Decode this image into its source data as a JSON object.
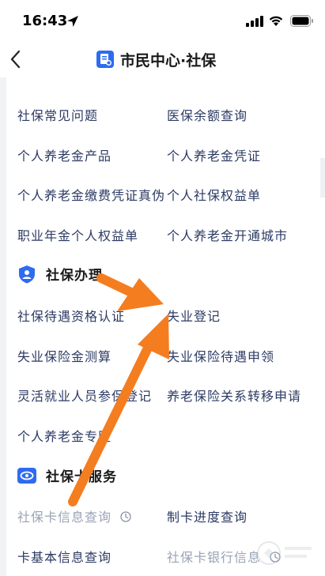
{
  "status_bar": {
    "time": "16:43"
  },
  "nav": {
    "title": "市民中心·社保"
  },
  "faq_items": [
    [
      "社保常见问题",
      "医保余额查询"
    ],
    [
      "个人养老金产品",
      "个人养老金凭证"
    ],
    [
      "个人养老金缴费凭证真伪",
      "个人社保权益单"
    ],
    [
      "职业年金个人权益单",
      "个人养老金开通城市"
    ]
  ],
  "sections": {
    "handling": {
      "title": "社保办理",
      "items": [
        [
          "社保待遇资格认证",
          "失业登记"
        ],
        [
          "失业保险金测算",
          "失业保险待遇申领"
        ],
        [
          "灵活就业人员参保登记",
          "养老保险关系转移申请"
        ],
        [
          "个人养老金专区",
          ""
        ]
      ]
    },
    "card": {
      "title": "社保卡服务",
      "items": [
        [
          "社保卡信息查询",
          "制卡进度查询"
        ],
        [
          "卡基本信息查询",
          "社保卡银行信息"
        ]
      ]
    }
  },
  "colors": {
    "accent": "#2f6bf0",
    "arrow": "#f47d20",
    "text": "#2c3a63"
  },
  "icons": {
    "back": "chevron-left-icon",
    "title_logo": "document-badge-icon",
    "handling": "shield-person-icon",
    "card": "eye-card-icon",
    "status": "clock-circle-icon"
  }
}
